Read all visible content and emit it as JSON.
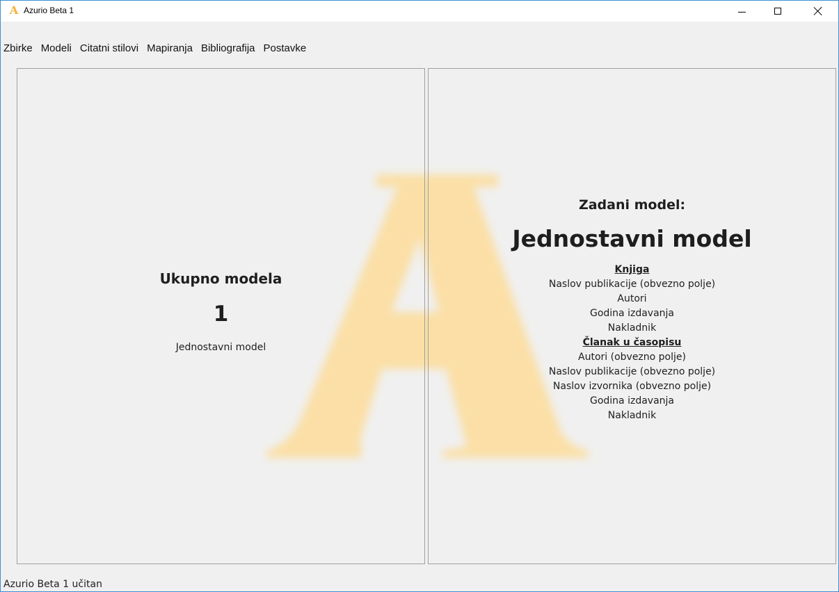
{
  "window": {
    "title": "Azurio Beta 1",
    "icon_glyph": "A",
    "icon": "azurio-logo-icon"
  },
  "menu": {
    "items": [
      "Zbirke",
      "Modeli",
      "Citatni stilovi",
      "Mapiranja",
      "Bibliografija",
      "Postavke"
    ]
  },
  "left_panel": {
    "heading": "Ukupno modela",
    "count": "1",
    "model_names": [
      "Jednostavni model"
    ]
  },
  "right_panel": {
    "default_label": "Zadani model:",
    "default_name": "Jednostavni model",
    "types": [
      {
        "title": "Knjiga",
        "fields": [
          "Naslov publikacije (obvezno polje)",
          "Autori",
          "Godina izdavanja",
          "Nakladnik"
        ]
      },
      {
        "title": "Članak u časopisu",
        "fields": [
          "Autori (obvezno polje)",
          "Naslov publikacije (obvezno polje)",
          "Naslov izvornika (obvezno polje)",
          "Godina izdavanja",
          "Nakladnik"
        ]
      }
    ]
  },
  "status": {
    "text": "Azurio Beta 1 učitan"
  },
  "colors": {
    "watermark": "#fbdfa6",
    "window_border": "#3b8fd6",
    "background": "#f0f0f0"
  }
}
